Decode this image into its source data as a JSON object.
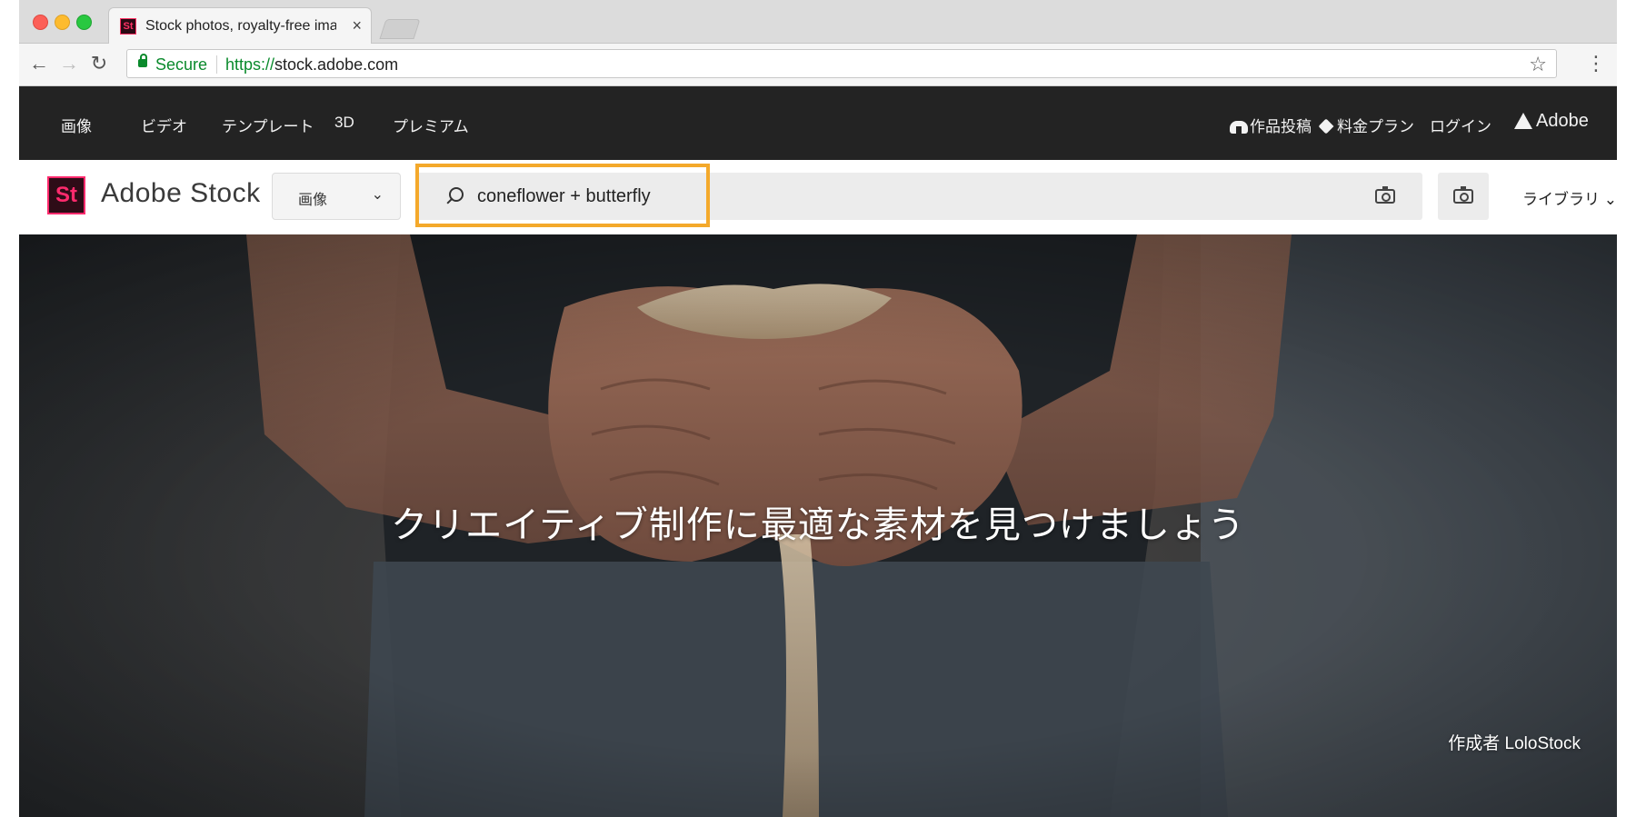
{
  "browser": {
    "tab_title": "Stock photos, royalty-free images",
    "tab_favicon_text": "St",
    "tab_close": "×",
    "secure_label": "Secure",
    "url_scheme": "https://",
    "url_host": "stock.adobe.com",
    "bookmark_star": "☆",
    "menu": "⋮"
  },
  "topnav": {
    "items": [
      "画像",
      "ビデオ",
      "テンプレート",
      "3D",
      "プレミアム"
    ],
    "upload_label": "作品投稿",
    "pricing_label": "料金プラン",
    "login_label": "ログイン",
    "adobe_label": "Adobe"
  },
  "stockbar": {
    "logo_text": "St",
    "brand_name": "Adobe Stock",
    "type_select": "画像",
    "search_value": "coneflower + butterfly",
    "library_label": "ライブラリ",
    "highlight_color": "#f4a92b"
  },
  "hero": {
    "headline": "クリエイティブ制作に最適な素材を見つけましょう",
    "credit": "作成者 LoloStock"
  }
}
